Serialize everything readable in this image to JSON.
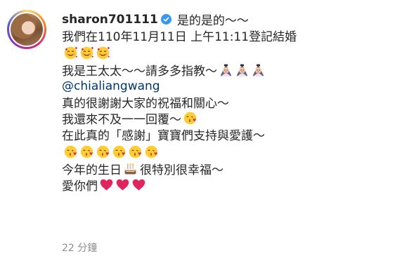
{
  "post": {
    "username": "sharon701111",
    "verified": true,
    "timestamp": "22 分鐘",
    "caption": {
      "line1": "是的是的～～",
      "line2": "我們在110年11月11日 上午11:11登記結婚",
      "line4": "我是王太太～～請多多指教～",
      "mention": "@chialiangwang",
      "line6": "真的很謝謝大家的祝福和關心～",
      "line7": "我還來不及一一回覆～",
      "line8": "在此真的「感謝」寶寶們支持與愛護～",
      "line10a": "今年的生日",
      "line10b": "很特別很幸福～",
      "line11": "愛你們"
    },
    "icons": {
      "smiling-hearts": "smiling-face-with-hearts-icon",
      "bride": "person-with-veil-icon",
      "kiss": "face-blowing-kiss-icon",
      "cake": "birthday-cake-icon",
      "heart": "red-heart-icon"
    },
    "colors": {
      "text": "#262626",
      "mention": "#00376b",
      "timestamp": "#8e8e8e",
      "verified": "#3897f0",
      "heart": "#e0245e"
    }
  }
}
